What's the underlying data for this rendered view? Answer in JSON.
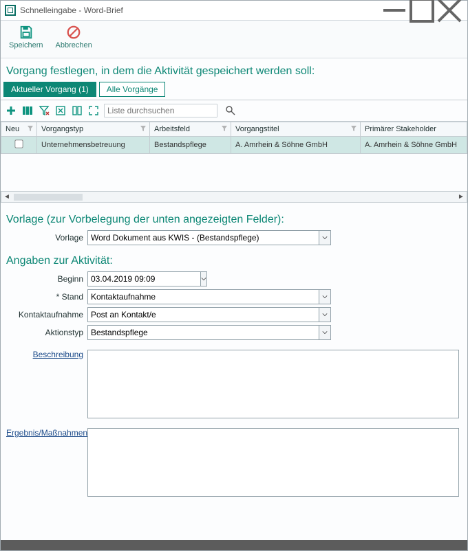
{
  "window": {
    "title": "Schnelleingabe - Word-Brief"
  },
  "toolbar": {
    "save": "Speichern",
    "cancel": "Abbrechen"
  },
  "section_vorgang": "Vorgang festlegen, in dem die Aktivität gespeichert werden soll:",
  "tabs": {
    "current": "Aktueller Vorgang",
    "current_count": "(1)",
    "all": "Alle Vorgänge"
  },
  "grid_toolbar": {
    "search_placeholder": "Liste durchsuchen"
  },
  "grid": {
    "columns": {
      "neu": "Neu",
      "typ": "Vorgangstyp",
      "arbeitsfeld": "Arbeitsfeld",
      "titel": "Vorgangstitel",
      "stakeholder": "Primärer Stakeholder"
    },
    "row": {
      "typ": "Unternehmensbetreuung",
      "arbeitsfeld": "Bestandspflege",
      "titel": "A. Amrhein & Söhne GmbH",
      "stakeholder": "A. Amrhein & Söhne GmbH"
    }
  },
  "section_vorlage": "Vorlage (zur Vorbelegung der unten angezeigten Felder):",
  "vorlage": {
    "label": "Vorlage",
    "value": "Word Dokument aus KWIS - (Bestandspflege)"
  },
  "section_angaben": "Angaben zur Aktivität:",
  "fields": {
    "beginn_label": "Beginn",
    "beginn_value": "03.04.2019 09:09",
    "stand_label": "* Stand",
    "stand_value": "Kontaktaufnahme",
    "kontakt_label": "Kontaktaufnahme",
    "kontakt_value": "Post an Kontakt/e",
    "aktionstyp_label": "Aktionstyp",
    "aktionstyp_value": "Bestandspflege",
    "beschreibung_label": "Beschreibung",
    "ergebnis_label": "Ergebnis/Maßnahmen"
  }
}
